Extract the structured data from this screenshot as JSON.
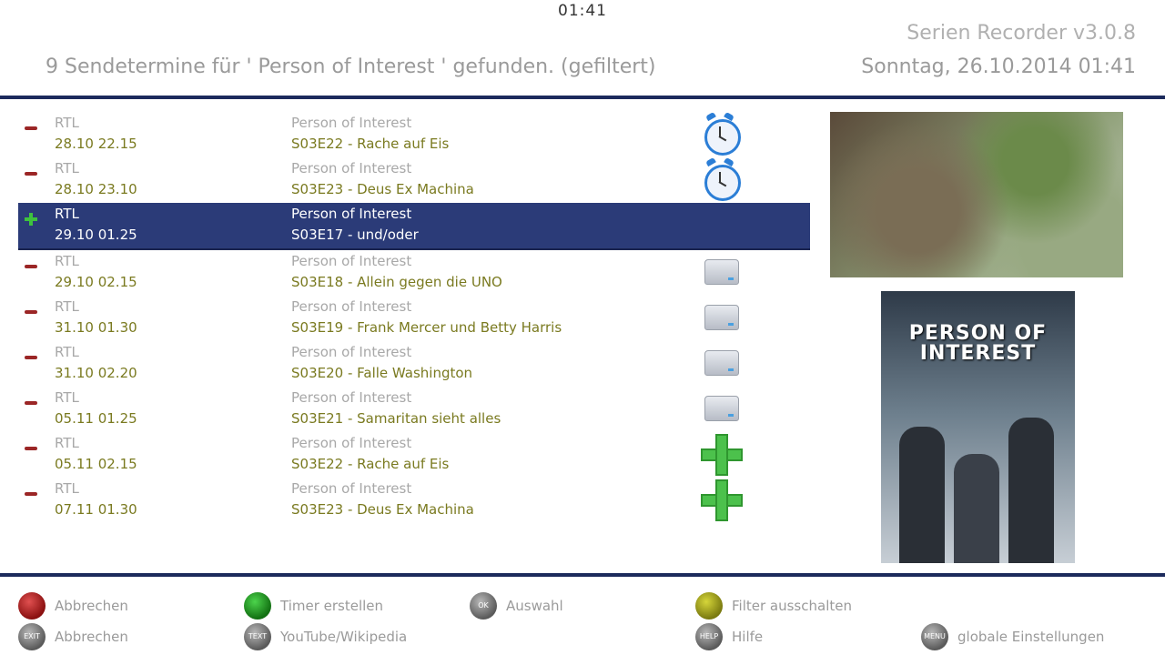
{
  "header": {
    "clock": "01:41",
    "app_title": "Serien Recorder v3.0.8",
    "heading": "9 Sendetermine für ' Person of Interest ' gefunden. (gefiltert)",
    "datetime": "Sonntag, 26.10.2014  01:41"
  },
  "rows": [
    {
      "status": "minus",
      "sender": "RTL",
      "time": "28.10 22.15",
      "series": "Person of Interest",
      "episode": "S03E22 - Rache auf Eis",
      "icon": "timer-clock-icon",
      "selected": false
    },
    {
      "status": "minus",
      "sender": "RTL",
      "time": "28.10 23.10",
      "series": "Person of Interest",
      "episode": "S03E23 - Deus Ex Machina",
      "icon": "timer-clock-icon",
      "selected": false
    },
    {
      "status": "plus",
      "sender": "RTL",
      "time": "29.10 01.25",
      "series": "Person of Interest",
      "episode": "S03E17 - und/oder",
      "icon": "",
      "selected": true
    },
    {
      "status": "minus",
      "sender": "RTL",
      "time": "29.10 02.15",
      "series": "Person of Interest",
      "episode": "S03E18 - Allein gegen die UNO",
      "icon": "recorded-disk-icon",
      "selected": false
    },
    {
      "status": "minus",
      "sender": "RTL",
      "time": "31.10 01.30",
      "series": "Person of Interest",
      "episode": "S03E19 - Frank Mercer und Betty Harris",
      "icon": "recorded-disk-icon",
      "selected": false
    },
    {
      "status": "minus",
      "sender": "RTL",
      "time": "31.10 02.20",
      "series": "Person of Interest",
      "episode": "S03E20 - Falle Washington",
      "icon": "recorded-disk-icon",
      "selected": false
    },
    {
      "status": "minus",
      "sender": "RTL",
      "time": "05.11 01.25",
      "series": "Person of Interest",
      "episode": "S03E21 - Samaritan sieht alles",
      "icon": "recorded-disk-icon",
      "selected": false
    },
    {
      "status": "minus",
      "sender": "RTL",
      "time": "05.11 02.15",
      "series": "Person of Interest",
      "episode": "S03E22 - Rache auf Eis",
      "icon": "add-timer-icon",
      "selected": false
    },
    {
      "status": "minus",
      "sender": "RTL",
      "time": "07.11 01.30",
      "series": "Person of Interest",
      "episode": "S03E23 - Deus Ex Machina",
      "icon": "add-timer-icon",
      "selected": false
    }
  ],
  "cover": {
    "title_line1": "PERSON OF",
    "title_line2": "INTEREST"
  },
  "buttons": {
    "red_label": "Abbrechen",
    "green_label": "Timer erstellen",
    "ok_label": "Auswahl",
    "yellow_label": "Filter ausschalten",
    "exit_label": "Abbrechen",
    "text_label": "YouTube/Wikipedia",
    "help_label": "Hilfe",
    "menu_label": "globale Einstellungen",
    "ok_tag": "OK",
    "exit_tag": "EXIT",
    "text_tag": "TEXT",
    "help_tag": "HELP",
    "menu_tag": "MENU"
  },
  "colors": {
    "accent": "#1c2a5c",
    "selected_bg": "#2b3b78",
    "episode_text": "#7a7a20"
  }
}
